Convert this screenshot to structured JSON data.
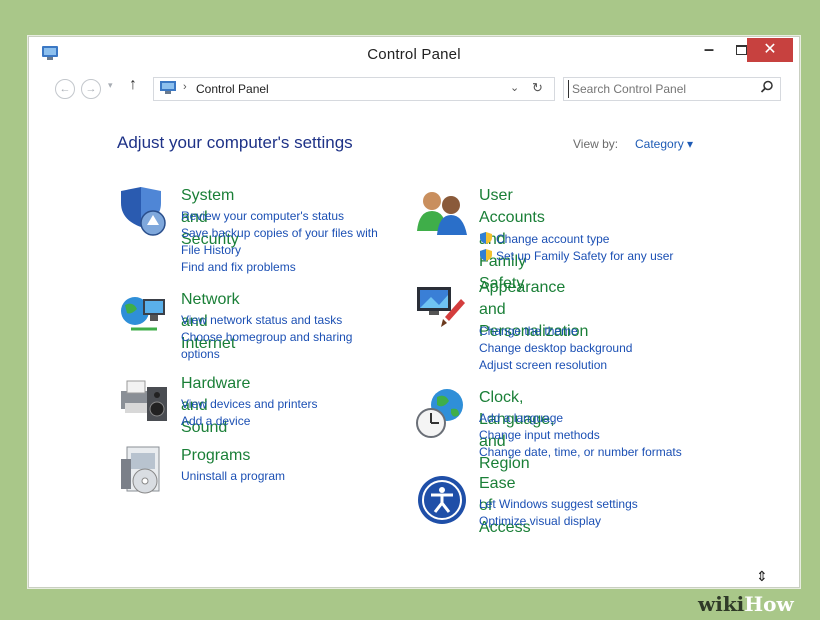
{
  "window": {
    "title": "Control Panel",
    "minimize": "–",
    "close": "✕"
  },
  "nav": {
    "up": "↑",
    "address": "Control Panel",
    "address_sep": "›",
    "search_placeholder": "Search Control Panel"
  },
  "main": {
    "heading": "Adjust your computer's settings",
    "view_by_label": "View by:",
    "view_by_value": "Category ▾"
  },
  "categories": [
    {
      "title": "System and Security",
      "icon": "shield-icon",
      "links": [
        "Review your computer's status",
        "Save backup copies of your files with",
        "File History",
        "Find and fix problems"
      ]
    },
    {
      "title": "Network and Internet",
      "icon": "globe-network-icon",
      "links": [
        "View network status and tasks",
        "Choose homegroup and sharing",
        "options"
      ]
    },
    {
      "title": "Hardware and Sound",
      "icon": "printer-speaker-icon",
      "links": [
        "View devices and printers",
        "Add a device"
      ]
    },
    {
      "title": "Programs",
      "icon": "programs-icon",
      "links": [
        "Uninstall a program"
      ]
    },
    {
      "title": "User Accounts and Family",
      "title2": "Safety",
      "icon": "users-icon",
      "links": [
        "Change account type",
        "Set up Family Safety for any user"
      ]
    },
    {
      "title": "Appearance and",
      "title2": "Personalization",
      "icon": "monitor-brush-icon",
      "links": [
        "Change the theme",
        "Change desktop background",
        "Adjust screen resolution"
      ]
    },
    {
      "title": "Clock, Language, and Region",
      "icon": "clock-globe-icon",
      "links": [
        "Add a language",
        "Change input methods",
        "Change date, time, or number formats"
      ]
    },
    {
      "title": "Ease of Access",
      "icon": "ease-of-access-icon",
      "links": [
        "Let Windows suggest settings",
        "Optimize visual display"
      ]
    }
  ],
  "watermark": {
    "wiki": "wiki",
    "how": "How"
  },
  "colors": {
    "link": "#1c50b4",
    "category": "#1a7f37",
    "heading": "#1e3287",
    "close": "#c7413f",
    "backdrop": "#a9c789"
  }
}
